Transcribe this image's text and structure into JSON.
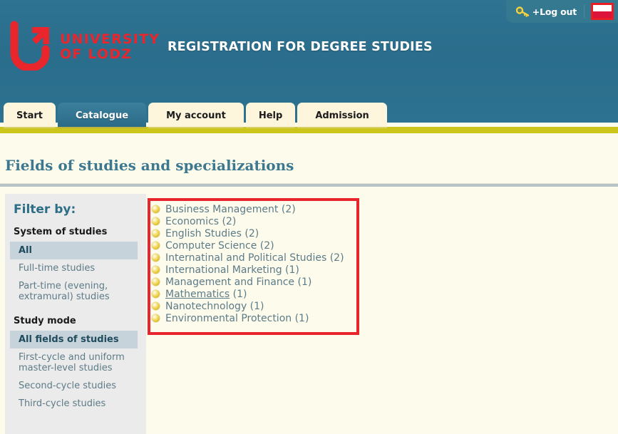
{
  "header": {
    "brand_line1": "UNIVERSITY",
    "brand_line2": "OF LODZ",
    "app_title": "REGISTRATION FOR DEGREE STUDIES",
    "logo_icon": "university-of-lodz-logo",
    "logout_label": "+Log out",
    "key_icon": "key-icon",
    "flag_icon": "polish-flag-icon",
    "colors": {
      "header_bg": "#2b6f8d",
      "brand_red": "#e8262c",
      "yellow_stripe": "#ccc51b",
      "highlight_red": "#e8252c"
    }
  },
  "tabs": [
    {
      "label": "Start",
      "active": false
    },
    {
      "label": "Catalogue",
      "active": true
    },
    {
      "label": "My account",
      "active": false
    },
    {
      "label": "Help",
      "active": false
    },
    {
      "label": "Admission",
      "active": false
    }
  ],
  "page": {
    "title": "Fields of studies and specializations"
  },
  "sidebar": {
    "heading": "Filter by:",
    "groups": [
      {
        "heading": "System of studies",
        "items": [
          {
            "label": "All",
            "selected": true
          },
          {
            "label": "Full-time studies",
            "selected": false
          },
          {
            "label": "Part-time (evening, extramural) studies",
            "selected": false
          }
        ]
      },
      {
        "heading": "Study mode",
        "items": [
          {
            "label": "All fields of studies",
            "selected": true
          },
          {
            "label": "First-cycle and uniform master-level studies",
            "selected": false
          },
          {
            "label": "Second-cycle studies",
            "selected": false
          },
          {
            "label": "Third-cycle studies",
            "selected": false
          }
        ]
      }
    ]
  },
  "fields": [
    {
      "name": "Business Management",
      "count": "(2)",
      "hovered": false
    },
    {
      "name": "Economics",
      "count": "(2)",
      "hovered": false
    },
    {
      "name": "English Studies",
      "count": "(2)",
      "hovered": false
    },
    {
      "name": "Computer Science",
      "count": "(2)",
      "hovered": false
    },
    {
      "name": "Internatinal and Political Studies",
      "count": "(2)",
      "hovered": false
    },
    {
      "name": "International Marketing",
      "count": "(1)",
      "hovered": false
    },
    {
      "name": "Management and Finance",
      "count": "(1)",
      "hovered": false
    },
    {
      "name": "Mathematics",
      "count": "(1)",
      "hovered": true
    },
    {
      "name": "Nanotechnology",
      "count": "(1)",
      "hovered": false
    },
    {
      "name": "Environmental Protection",
      "count": "(1)",
      "hovered": false
    }
  ]
}
